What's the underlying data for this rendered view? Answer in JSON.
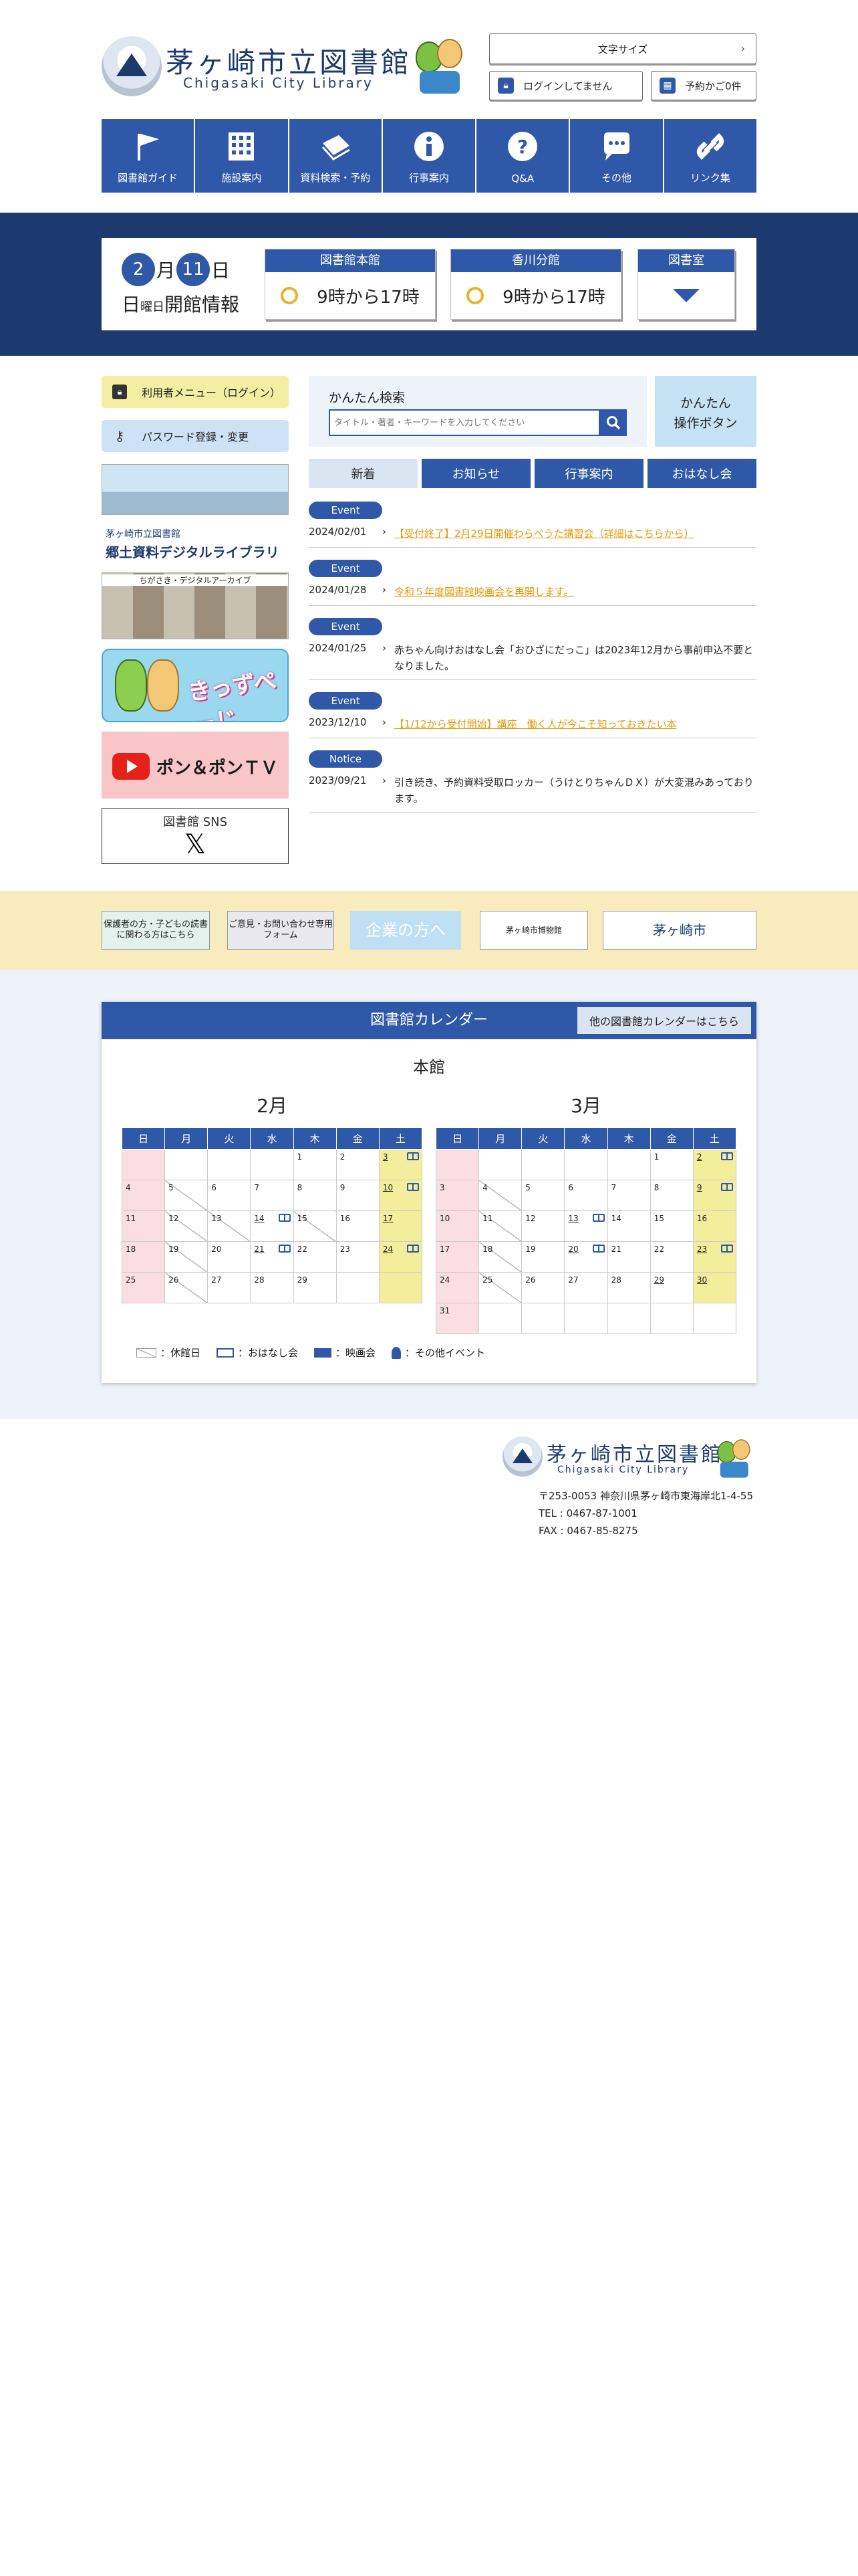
{
  "header": {
    "logo_title": "茅ヶ崎市立図書館",
    "logo_sub": "Chigasaki City Library",
    "font_size_label": "文字サイズ",
    "login_label": "ログインしてません",
    "cart_label": "予約かご0件"
  },
  "gnav": [
    {
      "label": "図書館ガイド",
      "icon": "flag-icon"
    },
    {
      "label": "施設案内",
      "icon": "building-icon"
    },
    {
      "label": "資料検索・予約",
      "icon": "book-icon"
    },
    {
      "label": "行事案内",
      "icon": "info-icon"
    },
    {
      "label": "Q&A",
      "icon": "question-icon"
    },
    {
      "label": "その他",
      "icon": "chat-icon"
    },
    {
      "label": "リンク集",
      "icon": "link-icon"
    }
  ],
  "hours": {
    "month": "2",
    "month_unit": "月",
    "day": "11",
    "day_unit": "日",
    "weekday": "日",
    "weekday_suffix": "曜日",
    "label": "開館情報",
    "main_name": "図書館本館",
    "main_hours": "9時から17時",
    "kagawa_name": "香川分館",
    "kagawa_hours": "9時から17時",
    "room_name": "図書室"
  },
  "side": {
    "user_menu": "利用者メニュー（ログイン）",
    "password": "パスワード登録・変更",
    "digital_small": "茅ヶ崎市立図書館",
    "digital_big": "郷土資料デジタルライブラリー",
    "archive": "ちがさき・デジタルアーカイブ",
    "kids": "きっずぺーじ",
    "tv": "ポン＆ポンＴＶ",
    "sns": "図書館 SNS",
    "x_mark": "𝕏"
  },
  "search": {
    "label": "かんたん検索",
    "placeholder": "タイトル・著者・キーワードを入力してください",
    "easy_line1": "かんたん",
    "easy_line2": "操作ボタン"
  },
  "tabs": [
    "新着",
    "お知らせ",
    "行事案内",
    "おはなし会"
  ],
  "news": [
    {
      "badge": "Event",
      "date": "2024/02/01",
      "title": "【受付終了】2月29日開催わらべうた講習会（詳細はこちらから）",
      "link": true
    },
    {
      "badge": "Event",
      "date": "2024/01/28",
      "title": "令和５年度図書館映画会を再開します。",
      "link": true
    },
    {
      "badge": "Event",
      "date": "2024/01/25",
      "title": "赤ちゃん向けおはなし会「おひざにだっこ」は2023年12月から事前申込不要となりました。",
      "link": false
    },
    {
      "badge": "Event",
      "date": "2023/12/10",
      "title": "【1/12から受付開始】講座　働く人が今こそ知っておきたい本",
      "link": true
    },
    {
      "badge": "Notice",
      "date": "2023/09/21",
      "title": "引き続き、予約資料受取ロッカー（うけとりちゃんＤＸ）が大変混みあっております。",
      "link": false
    }
  ],
  "strip": {
    "b1": "保護者の方・子どもの読書に関わる方はこちら",
    "b2": "ご意見・お問い合わせ専用フォーム",
    "b3": "企業の方へ",
    "b4": "茅ヶ崎市博物館",
    "b5": "茅ヶ崎市"
  },
  "calendar": {
    "title": "図書館カレンダー",
    "other": "他の図書館カレンダーはこちら",
    "branch": "本館",
    "weekdays": [
      "日",
      "月",
      "火",
      "水",
      "木",
      "金",
      "土"
    ],
    "feb_label": "2月",
    "mar_label": "3月",
    "legend_closed": "：休館日",
    "legend_story": "：おはなし会",
    "legend_film": "：映画会",
    "legend_event": "：その他イベント"
  },
  "footer": {
    "logo_title": "茅ヶ崎市立図書館",
    "logo_sub": "Chigasaki City Library",
    "address": "〒253-0053 神奈川県茅ヶ崎市東海岸北1-4-55",
    "tel": "TEL : 0467-87-1001",
    "fax": "FAX : 0467-85-8275"
  },
  "colors": {
    "primary": "#2f58a8",
    "navy": "#1d3a6e",
    "accent": "#e79a0c",
    "sat": "#f3ee9c",
    "sun": "#fbdde4"
  }
}
